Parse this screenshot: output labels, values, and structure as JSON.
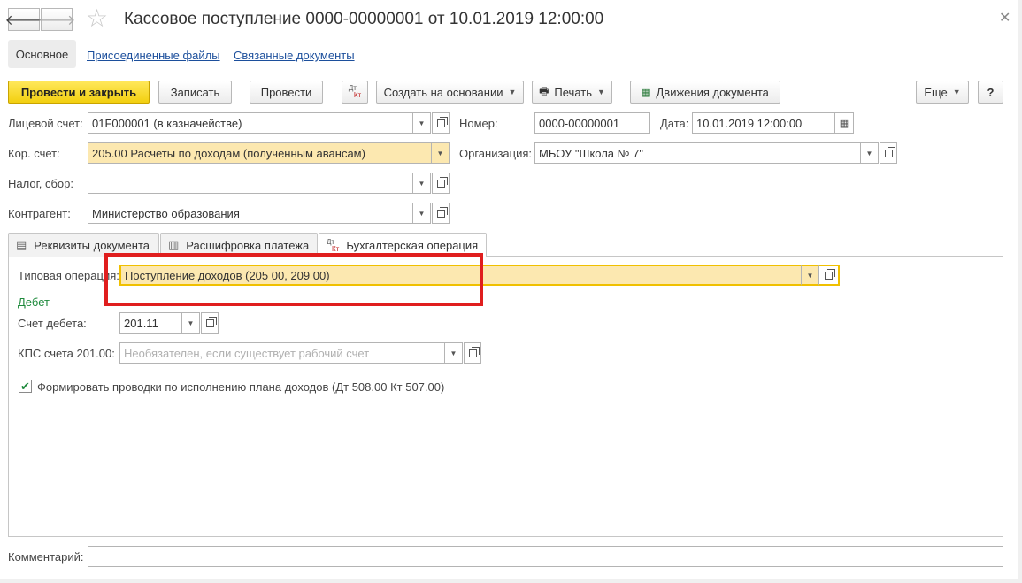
{
  "window": {
    "title": "Кассовое поступление 0000-00000001 от 10.01.2019 12:00:00",
    "back_icon": "arrow-left",
    "forward_icon": "arrow-right",
    "favorite_icon": "star",
    "close_icon": "close"
  },
  "section_tabs": {
    "main": "Основное",
    "files": "Присоединенные файлы",
    "related": "Связанные документы"
  },
  "toolbar": {
    "post_close": "Провести и закрыть",
    "save": "Записать",
    "post": "Провести",
    "dt_kt_top": "Дт",
    "dt_kt_bottom": "Кт",
    "create_based": "Создать на основании",
    "print": "Печать",
    "movements": "Движения документа",
    "more": "Еще",
    "help": "?"
  },
  "form": {
    "account_label": "Лицевой счет:",
    "account_value": "01F000001 (в казначействе)",
    "number_label": "Номер:",
    "number_value": "0000-00000001",
    "date_label": "Дата:",
    "date_value": "10.01.2019 12:00:00",
    "corr_label": "Кор. счет:",
    "corr_value": "205.00 Расчеты по доходам (полученным авансам)",
    "org_label": "Организация:",
    "org_value": "МБОУ \"Школа № 7\"",
    "tax_label": "Налог, сбор:",
    "tax_value": "",
    "counterparty_label": "Контрагент:",
    "counterparty_value": "Министерство образования"
  },
  "tabs": [
    {
      "label": "Реквизиты документа"
    },
    {
      "label": "Расшифровка платежа"
    },
    {
      "label": "Бухгалтерская операция"
    }
  ],
  "operation": {
    "type_label": "Типовая операция:",
    "type_value": "Поступление доходов (205 00, 209 00)",
    "debit_header": "Дебет",
    "debit_account_label": "Счет дебета:",
    "debit_account_value": "201.11",
    "kps_label": "КПС счета 201.00:",
    "kps_placeholder": "Необязателен, если существует рабочий счет",
    "checkbox_label": "Формировать проводки по исполнению плана доходов (Дт 508.00 Кт 507.00)",
    "checkbox_checked": true
  },
  "comment": {
    "label": "Комментарий:",
    "value": ""
  },
  "colors": {
    "accent_yellow": "#f2cf10",
    "highlight_field": "#fce8b0",
    "annotation_red": "#e01e1e",
    "link_blue": "#1c4f9c",
    "green_label": "#1e8a3c"
  }
}
